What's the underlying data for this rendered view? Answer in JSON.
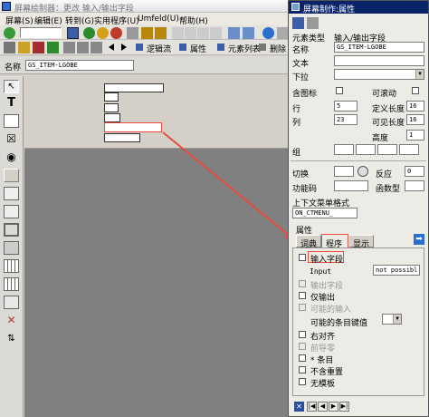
{
  "main_title": "屏幕绘制器：更改 输入/输出字段",
  "menu": [
    "屏幕(S)",
    "编辑(E)",
    "转到(G)",
    "实用程序(U)",
    "Umfeld(U)",
    "帮助(H)"
  ],
  "toolbar2": {
    "logic_flow": "逻辑流",
    "attributes": "属性",
    "element_list": "元素列表",
    "delete": "删除"
  },
  "name_row": {
    "label": "名称",
    "value": "GS_ITEM-LGOBE"
  },
  "attr_title": "屏幕制作:属性",
  "attrs": {
    "element_type_label": "元素类型",
    "element_type_value": "输入/输出字段",
    "name_label": "名称",
    "name_value": "GS_ITEM-LGOBE",
    "text_label": "文本",
    "dropdown_label": "下拉",
    "icon_label": "含图标",
    "scrollable_label": "可滚动",
    "row_label": "行",
    "row_value": "5",
    "def_len_label": "定义长度",
    "def_len_value": "16",
    "col_label": "列",
    "col_value": "23",
    "vis_len_label": "可见长度",
    "vis_len_value": "16",
    "height_label": "高度",
    "height_value": "1",
    "group_label": "组",
    "switch_label": "切换",
    "respond_label": "反应",
    "respond_value": "0",
    "func_code_label": "功能码",
    "func_type_label": "函数型",
    "context_menu_label": "上下文菜单格式",
    "context_menu_value": "ON_CTMENU_",
    "props_label": "属性"
  },
  "tabs": [
    "词典",
    "程序",
    "显示"
  ],
  "program_tab": {
    "input_field": "输入字段",
    "input_label": "Input",
    "input_value": "not possibl",
    "output_field": "输出字段",
    "output_only": "仅输出",
    "possible_input": "可能的输入",
    "possible_entries_key": "可能的条目键值",
    "right_justify": "右对齐",
    "leading_zeros": "前导零",
    "star_entry": "* 条目",
    "no_reset": "不含重置",
    "no_template": "无模板"
  },
  "colors": {
    "title_active": "#0a246a",
    "highlight": "#e74c3c"
  }
}
